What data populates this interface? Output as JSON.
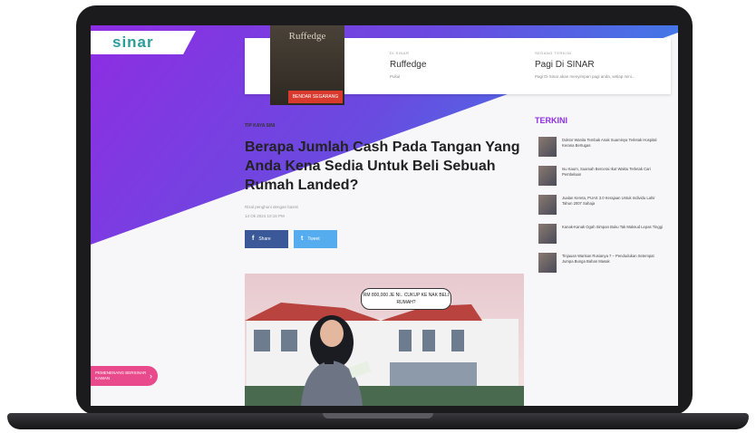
{
  "site": {
    "logo": "sinar"
  },
  "top_card": {
    "book_title": "Ruffedge",
    "book_button": "BENDAR SEGARANG",
    "col1": {
      "label": "DI SINAR",
      "title": "Ruffedge",
      "desc": "Pukul"
    },
    "col2": {
      "label": "SEDANG TERKINI",
      "title": "Pagi Di SINAR",
      "desc": "Pagi Di Sinar akan menyimpan pagi anda, setiap mini..."
    }
  },
  "article": {
    "category": "TIP KAYA SINI",
    "headline": "Berapa Jumlah Cash Pada Tangan Yang Anda Kena Sedia Untuk Beli Sebuah Rumah Landed?",
    "byline": "Rizal penghuni dengan basmi",
    "date": "14 Ok 2024 10:16 PM",
    "share": {
      "facebook": "Share",
      "twitter": "Tweet"
    },
    "image_bubble": "RM 800,000 JE NI.. CUKUP KE NAK BELI RUMAH?"
  },
  "sidebar": {
    "title": "TERKINI",
    "items": [
      {
        "text": "Doktor Wanita Tembak Anak Suaminya Terletak Hospital Kerana Bertugas"
      },
      {
        "text": "Isu Kaum, Suamah Bercerai Ikut Waktu Terletak Cari Pembelaan"
      },
      {
        "text": "Jualan Kereta, PUAS 3.0 Kerajaan Untuk Individu Lahir Tahun 2007 Sahaja"
      },
      {
        "text": "Kanak-Kanak Ogah Simpan Buku Tak Maksud Lepas Tinggi"
      },
      {
        "text": "Tinjauan Warisan Rusianya 7 – Pendudukan Setempat Jumpa Bunga Bahan Masak"
      }
    ]
  },
  "promo": {
    "label": "PEMENENANG BERSINAR KAWAN"
  },
  "colors": {
    "brand_teal": "#2a9d9a",
    "hero_purple": "#8e2de2",
    "facebook": "#3b5998",
    "twitter": "#55acee",
    "promo_pink": "#e84a8c"
  }
}
